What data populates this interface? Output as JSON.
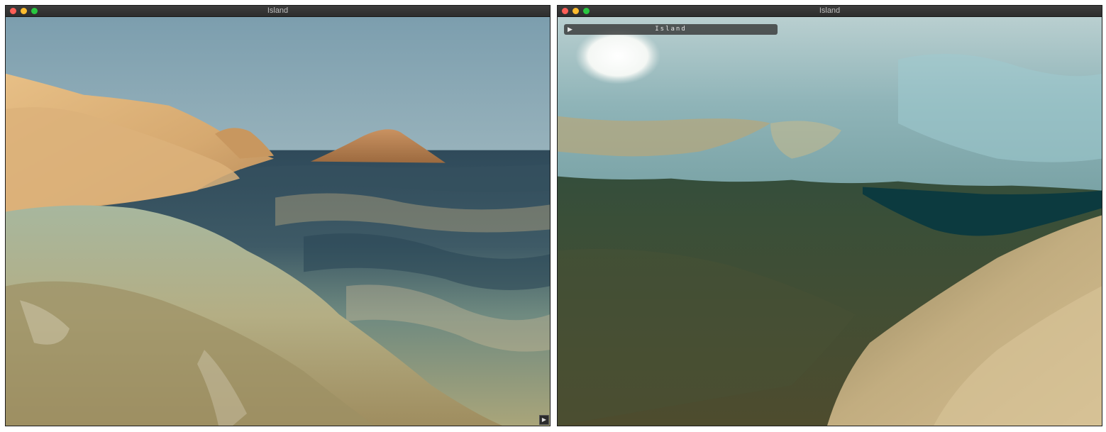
{
  "windows": [
    {
      "title": "Island",
      "corner_button_icon": "play-icon",
      "corner_button_glyph": "▶"
    },
    {
      "title": "Island",
      "panel": {
        "label": "Island",
        "toggle_icon": "play-icon",
        "toggle_glyph": "▶"
      }
    }
  ],
  "colors": {
    "titlebar": "#353535",
    "close": "#fe5f57",
    "minimize": "#febc2e",
    "maximize": "#28c840",
    "sand": "#d9b07a",
    "sky_top": "#7e9faf",
    "horizon": "#e8c79a",
    "deep_water": "#0f3b40"
  }
}
